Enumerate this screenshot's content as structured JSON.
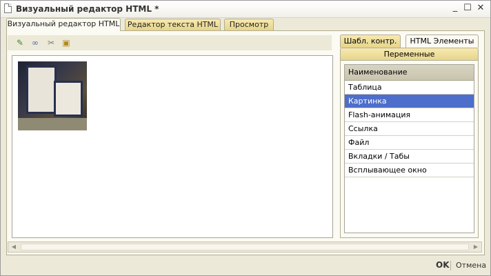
{
  "window": {
    "title": "Визуальный редактор HTML *",
    "minimize_icon": "minimize-icon",
    "maximize_icon": "maximize-icon",
    "close_icon": "close-icon"
  },
  "main_tabs": [
    {
      "label": "Визуальный редактор HTML",
      "active": true
    },
    {
      "label": "Редактор текста HTML",
      "active": false
    },
    {
      "label": "Просмотр",
      "active": false
    }
  ],
  "toolbar": {
    "icons": [
      "pencil-icon",
      "link-icon",
      "unlink-icon",
      "clipboard-icon"
    ]
  },
  "editor": {
    "content": "image-of-boxes"
  },
  "side_tabs": {
    "row1": [
      {
        "label": "Шабл. контр.",
        "active": false
      },
      {
        "label": "HTML Элементы",
        "active": true
      }
    ],
    "row2": [
      {
        "label": "Переменные",
        "active": false
      }
    ]
  },
  "elements_list": {
    "header": "Наименование",
    "items": [
      "Таблица",
      "Картинка",
      "Flash-анимация",
      "Ссылка",
      "Файл",
      "Вкладки / Табы",
      "Всплывающее окно"
    ],
    "selected_index": 1
  },
  "footer": {
    "ok_label": "OK",
    "cancel_label": "Отмена"
  },
  "colors": {
    "accent_selected": "#4d6ecb",
    "tab_gold": "#e6d48a"
  }
}
